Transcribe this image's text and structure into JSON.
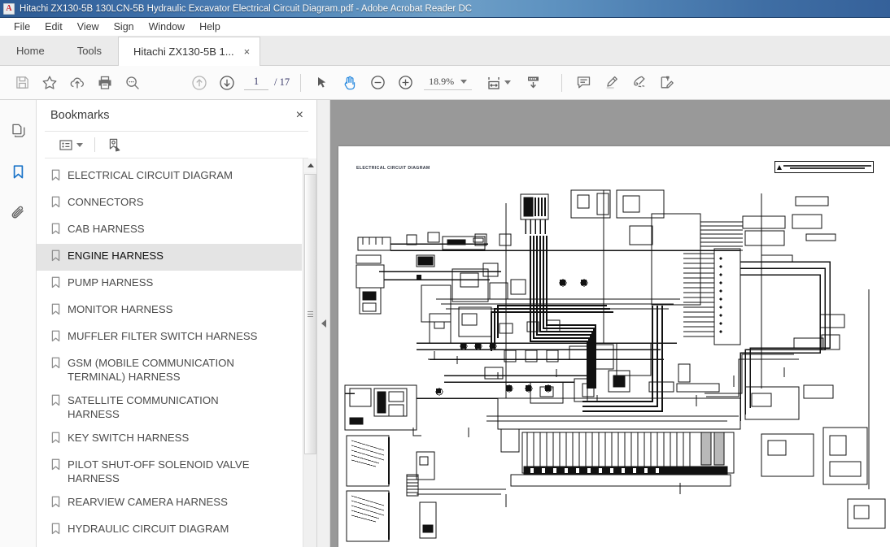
{
  "window": {
    "title": "Hitachi ZX130-5B 130LCN-5B Hydraulic Excavator Electrical Circuit Diagram.pdf - Adobe Acrobat Reader DC",
    "app_icon": "acrobat-logo-icon"
  },
  "menubar": {
    "items": [
      {
        "label": "File"
      },
      {
        "label": "Edit"
      },
      {
        "label": "View"
      },
      {
        "label": "Sign"
      },
      {
        "label": "Window"
      },
      {
        "label": "Help"
      }
    ]
  },
  "tabs": {
    "items": [
      {
        "label": "Home",
        "active": false
      },
      {
        "label": "Tools",
        "active": false
      },
      {
        "label": "Hitachi ZX130-5B 1...",
        "active": true
      }
    ],
    "close_glyph": "×"
  },
  "toolbar": {
    "save_icon": "save-icon",
    "star_icon": "star-icon",
    "upload_icon": "upload-cloud-icon",
    "print_icon": "print-icon",
    "search_icon": "search-icon",
    "prev_page_icon": "arrow-up-circle-icon",
    "next_page_icon": "arrow-down-circle-icon",
    "page_current": "1",
    "page_separator": "/ 17",
    "page_total": "17",
    "select_icon": "cursor-select-icon",
    "hand_icon": "hand-tool-icon",
    "zoom_out_icon": "zoom-out-icon",
    "zoom_in_icon": "zoom-in-icon",
    "zoom_level": "18.9%",
    "fit_page_icon": "fit-page-icon",
    "scroll_mode_icon": "scroll-down-icon",
    "comment_icon": "comment-icon",
    "highlight_icon": "highlight-icon",
    "sign_icon": "sign-icon",
    "fill-sign_icon": "fill-and-sign-icon"
  },
  "rail": {
    "items": [
      {
        "name": "page-thumbnails-icon",
        "label": "Page Thumbnails",
        "active": false
      },
      {
        "name": "bookmarks-icon",
        "label": "Bookmarks",
        "active": true
      },
      {
        "name": "attachments-icon",
        "label": "Attachments",
        "active": false
      }
    ]
  },
  "bookmarks_panel": {
    "title": "Bookmarks",
    "close_glyph": "×",
    "options_icon": "list-options-icon",
    "new_bookmark_icon": "new-bookmark-icon",
    "items": [
      {
        "label": "ELECTRICAL CIRCUIT DIAGRAM",
        "selected": false
      },
      {
        "label": "CONNECTORS",
        "selected": false
      },
      {
        "label": "CAB HARNESS",
        "selected": false
      },
      {
        "label": "ENGINE HARNESS",
        "selected": true
      },
      {
        "label": "PUMP HARNESS",
        "selected": false
      },
      {
        "label": "MONITOR HARNESS",
        "selected": false
      },
      {
        "label": "MUFFLER FILTER SWITCH HARNESS",
        "selected": false
      },
      {
        "label": "GSM (MOBILE COMMUNICATION TERMINAL) HARNESS",
        "selected": false
      },
      {
        "label": "SATELLITE COMMUNICATION HARNESS",
        "selected": false
      },
      {
        "label": "KEY SWITCH HARNESS",
        "selected": false
      },
      {
        "label": "PILOT SHUT-OFF SOLENOID VALVE HARNESS",
        "selected": false
      },
      {
        "label": "REARVIEW CAMERA HARNESS",
        "selected": false
      },
      {
        "label": "HYDRAULIC CIRCUIT DIAGRAM",
        "selected": false
      }
    ]
  },
  "document": {
    "page_title": "ELECTRICAL CIRCUIT DIAGRAM",
    "warning_icon": "warning-triangle-icon",
    "background_color": "#999999",
    "page_color": "#ffffff"
  }
}
